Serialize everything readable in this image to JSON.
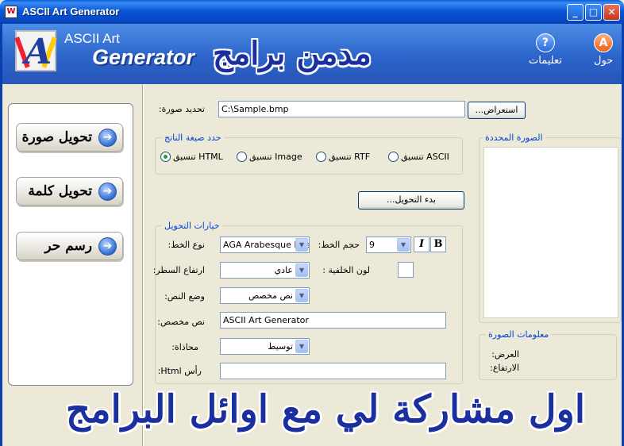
{
  "window": {
    "title": "ASCII Art Generator",
    "minimize": "_",
    "maximize": "□",
    "close": "✕"
  },
  "header": {
    "brand_line1": "ASCII Art",
    "brand_line2": "Generator",
    "overlay": "مدمن برامج",
    "help_label": "تعليمات",
    "about_label": "حول",
    "help_icon": "?",
    "about_icon": "A"
  },
  "sidebar": {
    "items": [
      {
        "label": "تحويل صورة"
      },
      {
        "label": "تحويل كلمة"
      },
      {
        "label": "رسم حر"
      }
    ],
    "arrow": "➔"
  },
  "image_select": {
    "label": "تحديد صورة:",
    "path": "C:\\Sample.bmp",
    "browse_label": "استعراض..."
  },
  "output_format": {
    "legend": "حدد صيغة الناتج",
    "options": [
      {
        "label": "تنسيق HTML",
        "selected": true
      },
      {
        "label": "تنسيق Image",
        "selected": false
      },
      {
        "label": "تنسيق RTF",
        "selected": false
      },
      {
        "label": "تنسيق ASCII",
        "selected": false
      }
    ]
  },
  "convert_button": "بدء التحويل...",
  "options": {
    "legend": "خيارات التحويل",
    "font_type_label": "نوع الخط:",
    "font_type_value": "AGA Arabesque Des",
    "font_size_label": "حجم الخط:",
    "font_size_value": "9",
    "italic": "I",
    "bold": "B",
    "line_height_label": "ارتفاع السطر:",
    "line_height_value": "عادي",
    "bg_color_label": "لون الخلفية :",
    "text_mode_label": "وضع النص:",
    "text_mode_value": "نص مخصص",
    "custom_text_label": "نص مخصص:",
    "custom_text_value": "ASCII Art Generator",
    "align_label": "محاذاة:",
    "align_value": "توسيط",
    "html_head_label": "رأس Html:",
    "html_head_value": ""
  },
  "preview": {
    "legend": "الصورة المحددة"
  },
  "image_info": {
    "legend": "معلومات الصورة",
    "width_label": "العرض:",
    "height_label": "الارتفاع:"
  },
  "footer_overlay": "اول مشاركة لي مع اوائل البرامج",
  "colors": {
    "titlebar": "#0857d9",
    "banner": "#2c64c9",
    "legend_text": "#0046d5",
    "overlay_text": "#1b2f9e"
  }
}
